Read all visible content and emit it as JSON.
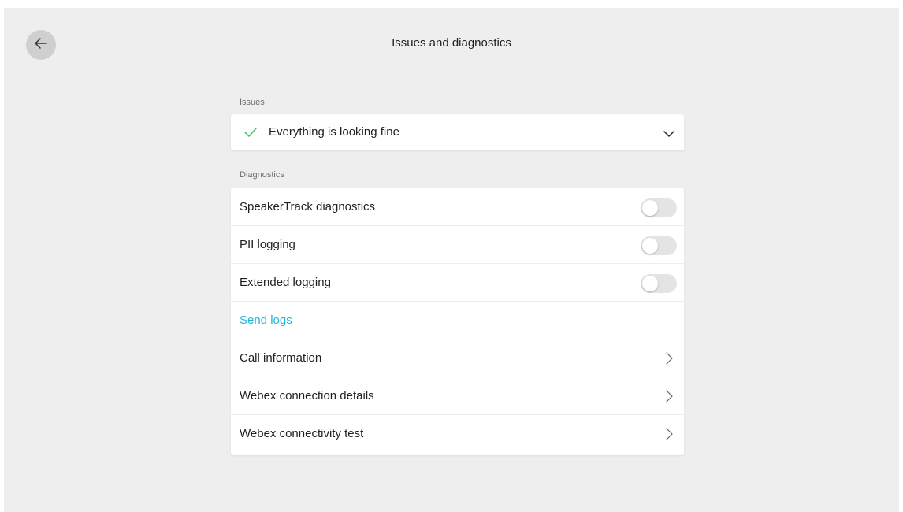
{
  "header": {
    "title": "Issues and diagnostics",
    "back_icon": "arrow-left-icon"
  },
  "issues": {
    "section_label": "Issues",
    "status_text": "Everything is looking fine",
    "status_icon": "check-icon",
    "status_color": "#3fbf5f",
    "expand_icon": "chevron-down-icon"
  },
  "diagnostics": {
    "section_label": "Diagnostics",
    "link_color": "#1fb7d9",
    "items": [
      {
        "label": "SpeakerTrack diagnostics",
        "type": "toggle",
        "on": false
      },
      {
        "label": "PII logging",
        "type": "toggle",
        "on": false
      },
      {
        "label": "Extended logging",
        "type": "toggle",
        "on": false
      },
      {
        "label": "Send logs",
        "type": "link"
      },
      {
        "label": "Call information",
        "type": "nav",
        "icon": "chevron-right-icon"
      },
      {
        "label": "Webex connection details",
        "type": "nav",
        "icon": "chevron-right-icon"
      },
      {
        "label": "Webex connectivity test",
        "type": "nav",
        "icon": "chevron-right-icon"
      }
    ]
  }
}
